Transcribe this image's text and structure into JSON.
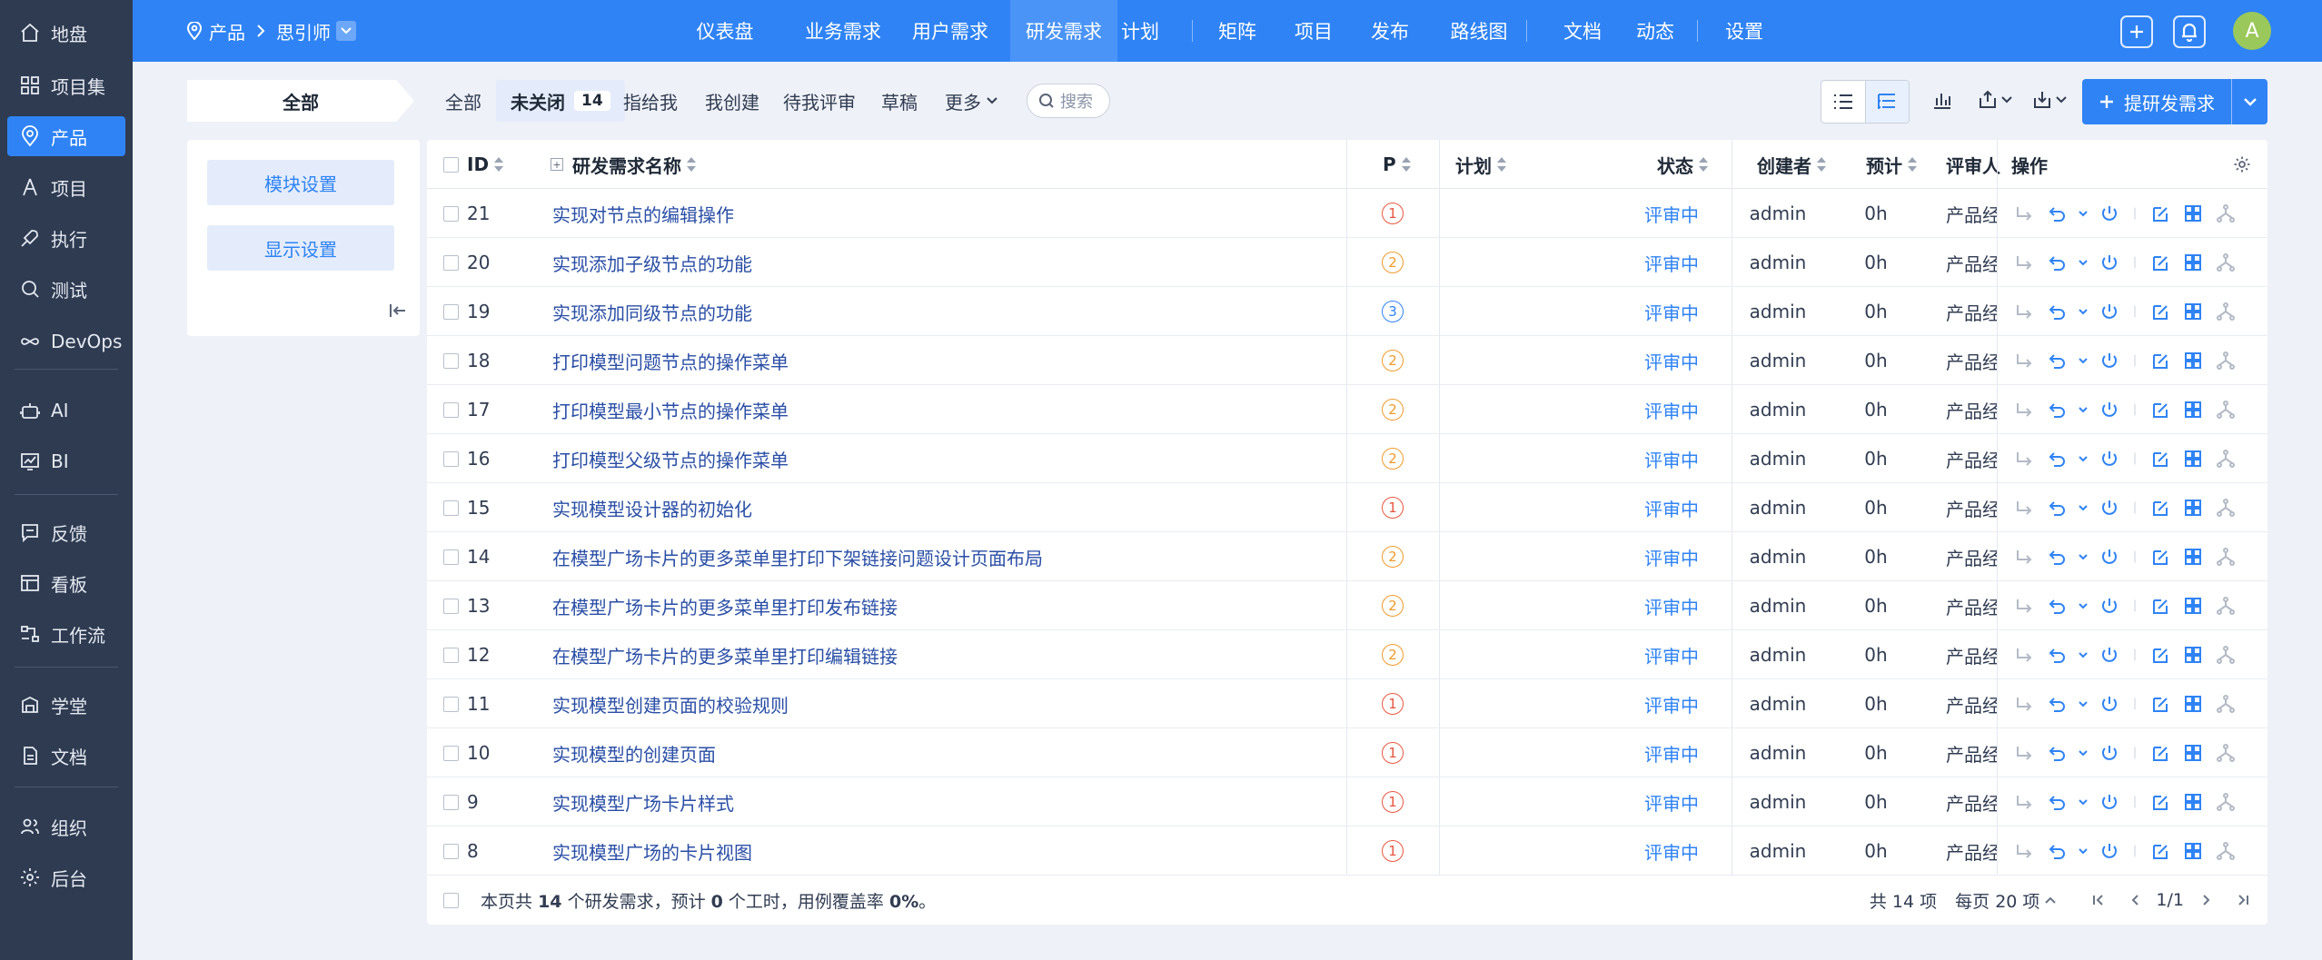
{
  "sidebar": {
    "items": [
      {
        "label": "地盘",
        "icon": "home-icon"
      },
      {
        "label": "项目集",
        "icon": "grid-icon"
      },
      {
        "label": "产品",
        "icon": "location-pin-icon",
        "active": true
      },
      {
        "label": "项目",
        "icon": "project-icon"
      },
      {
        "label": "执行",
        "icon": "rocket-icon"
      },
      {
        "label": "测试",
        "icon": "magnifier-icon"
      },
      {
        "label": "DevOps",
        "icon": "infinity-icon"
      },
      {
        "label": "AI",
        "icon": "robot-icon"
      },
      {
        "label": "BI",
        "icon": "chart-board-icon"
      },
      {
        "label": "反馈",
        "icon": "feedback-icon"
      },
      {
        "label": "看板",
        "icon": "kanban-icon"
      },
      {
        "label": "工作流",
        "icon": "workflow-icon"
      },
      {
        "label": "学堂",
        "icon": "school-icon"
      },
      {
        "label": "文档",
        "icon": "document-icon"
      },
      {
        "label": "组织",
        "icon": "people-icon"
      },
      {
        "label": "后台",
        "icon": "gear-icon"
      }
    ]
  },
  "topbar": {
    "breadcrumb_root": "产品",
    "breadcrumb_product": "思引师",
    "nav": [
      "仪表盘",
      "业务需求",
      "用户需求",
      "研发需求",
      "计划",
      "矩阵",
      "项目",
      "发布",
      "路线图",
      "文档",
      "动态",
      "设置"
    ],
    "active_nav": "研发需求",
    "avatar_letter": "A"
  },
  "toolbar": {
    "all_label": "全部",
    "tabs": [
      "全部",
      "未关闭",
      "指给我",
      "我创建",
      "待我评审",
      "草稿",
      "更多"
    ],
    "active_tab": "未关闭",
    "active_count": "14",
    "search_placeholder": "搜索",
    "create_button": "提研发需求"
  },
  "module_panel": {
    "module_settings": "模块设置",
    "display_settings": "显示设置"
  },
  "table": {
    "headers": {
      "id": "ID",
      "title": "研发需求名称",
      "pri": "P",
      "plan": "计划",
      "status": "状态",
      "creator": "创建者",
      "estimate": "预计",
      "reviewer": "评审人",
      "actions": "操作"
    },
    "rows": [
      {
        "id": "21",
        "title": "实现对节点的编辑操作",
        "pri": "1",
        "plan": "",
        "status": "评审中",
        "creator": "admin",
        "estimate": "0h",
        "reviewer": "产品经"
      },
      {
        "id": "20",
        "title": "实现添加子级节点的功能",
        "pri": "2",
        "plan": "",
        "status": "评审中",
        "creator": "admin",
        "estimate": "0h",
        "reviewer": "产品经"
      },
      {
        "id": "19",
        "title": "实现添加同级节点的功能",
        "pri": "3",
        "plan": "",
        "status": "评审中",
        "creator": "admin",
        "estimate": "0h",
        "reviewer": "产品经"
      },
      {
        "id": "18",
        "title": "打印模型问题节点的操作菜单",
        "pri": "2",
        "plan": "",
        "status": "评审中",
        "creator": "admin",
        "estimate": "0h",
        "reviewer": "产品经"
      },
      {
        "id": "17",
        "title": "打印模型最小节点的操作菜单",
        "pri": "2",
        "plan": "",
        "status": "评审中",
        "creator": "admin",
        "estimate": "0h",
        "reviewer": "产品经"
      },
      {
        "id": "16",
        "title": "打印模型父级节点的操作菜单",
        "pri": "2",
        "plan": "",
        "status": "评审中",
        "creator": "admin",
        "estimate": "0h",
        "reviewer": "产品经"
      },
      {
        "id": "15",
        "title": "实现模型设计器的初始化",
        "pri": "1",
        "plan": "",
        "status": "评审中",
        "creator": "admin",
        "estimate": "0h",
        "reviewer": "产品经"
      },
      {
        "id": "14",
        "title": "在模型广场卡片的更多菜单里打印下架链接问题设计页面布局",
        "pri": "2",
        "plan": "",
        "status": "评审中",
        "creator": "admin",
        "estimate": "0h",
        "reviewer": "产品经"
      },
      {
        "id": "13",
        "title": "在模型广场卡片的更多菜单里打印发布链接",
        "pri": "2",
        "plan": "",
        "status": "评审中",
        "creator": "admin",
        "estimate": "0h",
        "reviewer": "产品经"
      },
      {
        "id": "12",
        "title": "在模型广场卡片的更多菜单里打印编辑链接",
        "pri": "2",
        "plan": "",
        "status": "评审中",
        "creator": "admin",
        "estimate": "0h",
        "reviewer": "产品经"
      },
      {
        "id": "11",
        "title": "实现模型创建页面的校验规则",
        "pri": "1",
        "plan": "",
        "status": "评审中",
        "creator": "admin",
        "estimate": "0h",
        "reviewer": "产品经"
      },
      {
        "id": "10",
        "title": "实现模型的创建页面",
        "pri": "1",
        "plan": "",
        "status": "评审中",
        "creator": "admin",
        "estimate": "0h",
        "reviewer": "产品经"
      },
      {
        "id": "9",
        "title": "实现模型广场卡片样式",
        "pri": "1",
        "plan": "",
        "status": "评审中",
        "creator": "admin",
        "estimate": "0h",
        "reviewer": "产品经"
      },
      {
        "id": "8",
        "title": "实现模型广场的卡片视图",
        "pri": "1",
        "plan": "",
        "status": "评审中",
        "creator": "admin",
        "estimate": "0h",
        "reviewer": "产品经"
      }
    ],
    "footer": {
      "prefix": "本页共",
      "count": "14",
      "mid1": "个研发需求，预计",
      "hours": "0",
      "mid2": "个工时，用例覆盖率",
      "coverage": "0%",
      "suffix": "。"
    },
    "pager": {
      "total": "共 14 项",
      "per_page": "每页 20 项",
      "page": "1/1"
    }
  },
  "colors": {
    "primary": "#2f83f5",
    "pri1": "#e8563f",
    "pri2": "#f09a2b",
    "pri3": "#2f83f5",
    "sidebar_bg": "#2e3b51"
  }
}
